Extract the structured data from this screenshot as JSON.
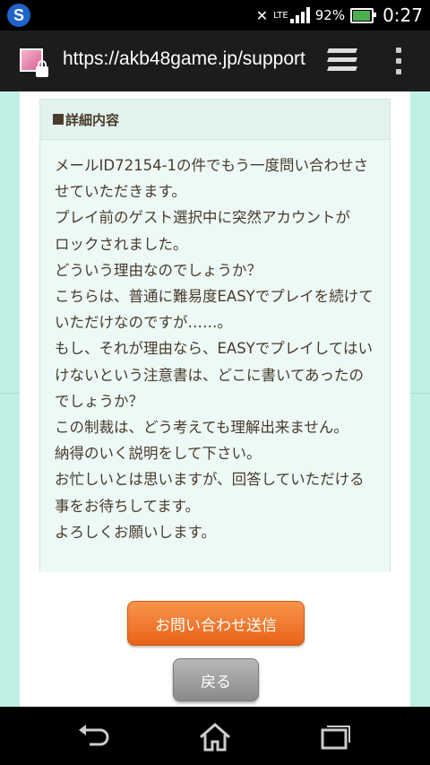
{
  "status_bar": {
    "lte": "LTE",
    "battery_pct": "92%",
    "time": "0:27",
    "icons": [
      "app-s-icon",
      "bluetooth-mute-icon",
      "signal-icon",
      "battery-charging-icon"
    ]
  },
  "browser": {
    "url": "https://akb48game.jp/support",
    "icons": [
      "site-favicon",
      "lock-icon",
      "tabs-icon",
      "overflow-menu-icon"
    ]
  },
  "detail": {
    "header": "詳細内容",
    "lines": [
      "メールID72154-1の件でもう一度問い合わせさ",
      "せていただきます。",
      "プレイ前のゲスト選択中に突然アカウントが",
      "ロックされました。",
      "どういう理由なのでしょうか？",
      "こちらは、普通に難易度EASYでプレイを続けて",
      "いただけなのですが……。",
      "もし、それが理由なら、EASYでプレイしてはい",
      "けないという注意書は、どこに書いてあったの",
      "でしょうか？",
      "この制裁は、どう考えても理解出来ません。",
      "納得のいく説明をして下さい。",
      "お忙しいとは思いますが、回答していただける",
      "事をお待ちしてます。",
      "よろしくお願いします。"
    ]
  },
  "buttons": {
    "submit_label": "お問い合わせ送信",
    "back_label": "戻る"
  },
  "colors": {
    "page_bg": "#bff0e6",
    "text": "#4a3b2b",
    "submit": "#ee7427",
    "back": "#9e9e9e"
  },
  "nav_bar": {
    "icons": [
      "back-icon",
      "home-icon",
      "recent-apps-icon"
    ]
  }
}
